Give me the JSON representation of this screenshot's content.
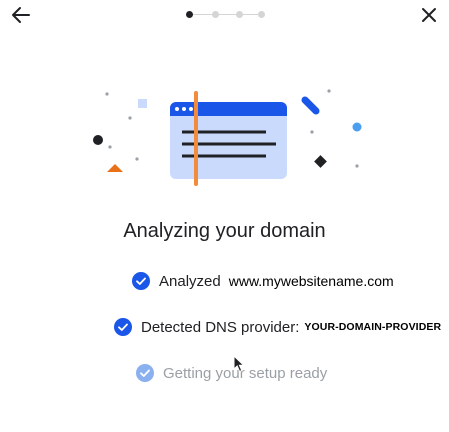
{
  "colors": {
    "accent_blue": "#1a56e8",
    "pending_blue": "#8ab0f0",
    "illustration_window": "#c9dafc",
    "illustration_line": "#f28b3c"
  },
  "header": {
    "back_icon": "arrow-left-icon",
    "close_icon": "close-icon",
    "steps_total": 4,
    "current_step": 1
  },
  "main": {
    "title": "Analyzing your domain",
    "statuses": [
      {
        "label": "Analyzed",
        "value": "www.mywebsitename.com",
        "state": "done",
        "icon": "check-circle-icon"
      },
      {
        "label": "Detected DNS provider:",
        "value": "YOUR-DOMAIN-PROVIDER",
        "state": "done",
        "icon": "check-circle-icon"
      },
      {
        "label": "Getting your setup ready",
        "state": "pending",
        "icon": "check-circle-icon"
      }
    ]
  }
}
